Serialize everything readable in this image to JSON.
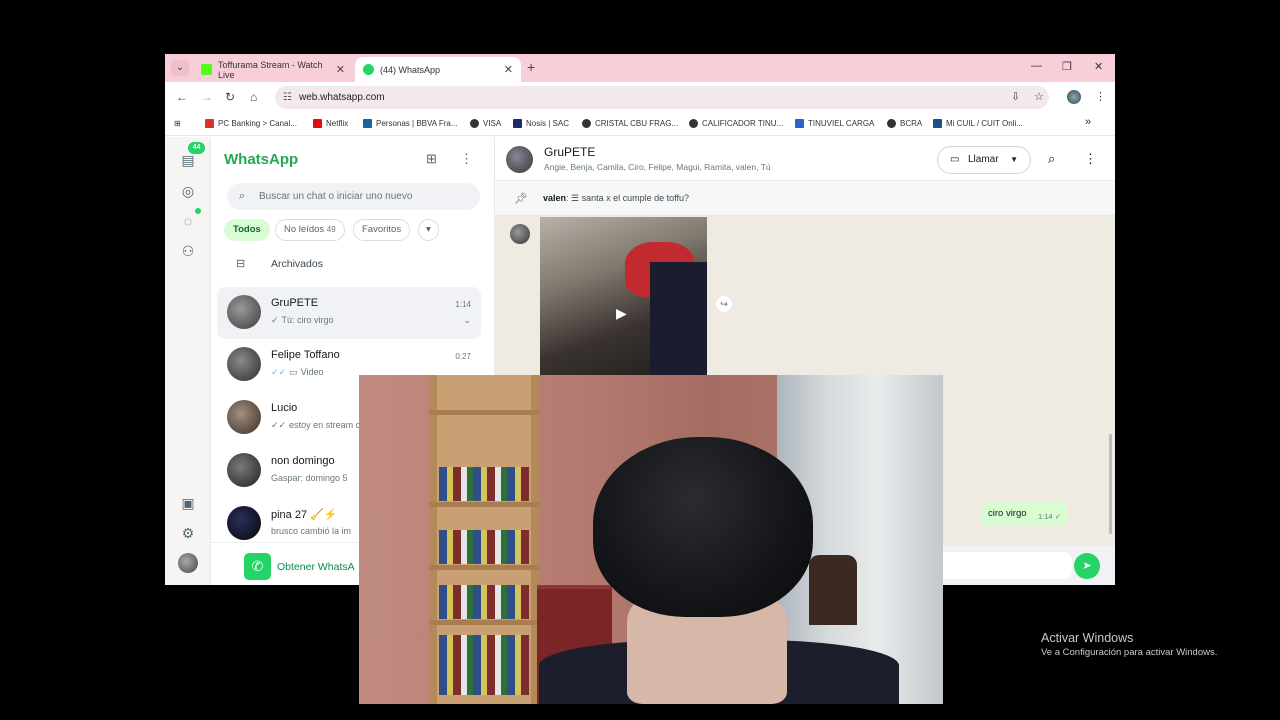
{
  "browser": {
    "tabs": [
      {
        "label": "Toffurama Stream - Watch Live",
        "favicon_color": "#53fc18"
      },
      {
        "label": "(44) WhatsApp",
        "favicon_color": "#25d366"
      }
    ],
    "new_tab_label": "+",
    "url": "web.whatsapp.com",
    "bookmarks": [
      {
        "label": "PC Banking > Canal...",
        "color": "#d8312b"
      },
      {
        "label": "Netflix",
        "color": "#e50914"
      },
      {
        "label": "Personas | BBVA Fra...",
        "color": "#1464a5"
      },
      {
        "label": "VISA",
        "color": "#333333"
      },
      {
        "label": "Nosis | SAC",
        "color": "#1b2a6b"
      },
      {
        "label": "CRISTAL CBU FRAG...",
        "color": "#333333"
      },
      {
        "label": "CALIFICADOR TINU...",
        "color": "#333333"
      },
      {
        "label": "TINUVIEL CARGA",
        "color": "#2a62c9"
      },
      {
        "label": "BCRA",
        "color": "#333333"
      },
      {
        "label": "Mi CUIL / CUIT Onli...",
        "color": "#1b4f8a"
      }
    ],
    "more_bookmarks": "»"
  },
  "whatsapp": {
    "rail": {
      "unread_badge": "44"
    },
    "title": "WhatsApp",
    "search_placeholder": "Buscar un chat o iniciar uno nuevo",
    "filters": {
      "all": "Todos",
      "unread": "No leídos",
      "unread_count": "49",
      "favorites": "Favoritos",
      "more": "▾"
    },
    "archived": "Archivados",
    "chats": [
      {
        "name": "GruPETE",
        "time": "1:14",
        "last": "Tú: ciro virgo",
        "tick": "✓"
      },
      {
        "name": "Felipe Toffano",
        "time": "0:27",
        "last": "Video",
        "tick": "✓✓"
      },
      {
        "name": "Lucio",
        "time": "",
        "last": "estoy en stream c",
        "tick": "✓✓"
      },
      {
        "name": "non domingo",
        "time": "",
        "last": "Gaspar: domingo 5",
        "tick": ""
      },
      {
        "name": "pina 27 🧹⚡",
        "time": "",
        "last": "brusco cambió la im",
        "tick": ""
      }
    ],
    "get_app": "Obtener WhatsA",
    "chat": {
      "name": "GruPETE",
      "members": "Angie, Benja, Camila, Ciro, Felipe, Magui, Ramita, valen, Tú",
      "call_label": "Llamar",
      "pinned_sender": "valen",
      "pinned_text": "santa x el cumple de toffu?",
      "outgoing_text": "ciro virgo",
      "outgoing_time": "1:14"
    }
  },
  "windows_watermark": {
    "title": "Activar Windows",
    "subtitle": "Ve a Configuración para activar Windows."
  }
}
